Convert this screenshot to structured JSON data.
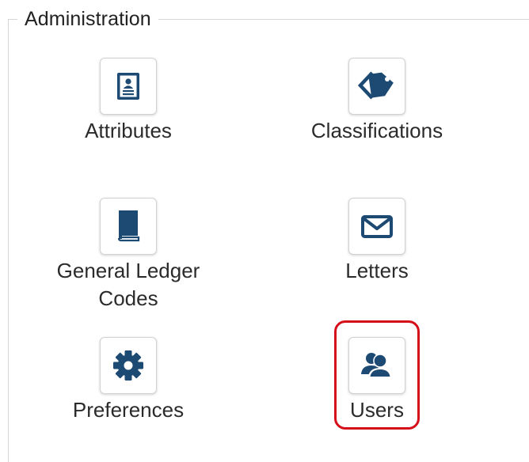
{
  "section": {
    "title": "Administration"
  },
  "tiles": [
    {
      "label": "Attributes",
      "icon": "id-card-icon"
    },
    {
      "label": "Classifications",
      "icon": "tags-icon"
    },
    {
      "label_line1": "General Ledger",
      "label_line2": "Codes",
      "icon": "book-icon"
    },
    {
      "label": "Letters",
      "icon": "envelope-icon"
    },
    {
      "label": "Preferences",
      "icon": "gear-icon"
    },
    {
      "label": "Users",
      "icon": "users-icon",
      "highlighted": true
    }
  ],
  "colors": {
    "icon": "#1d4a73",
    "highlight": "#d50f1a",
    "text": "#2b2b2b"
  }
}
